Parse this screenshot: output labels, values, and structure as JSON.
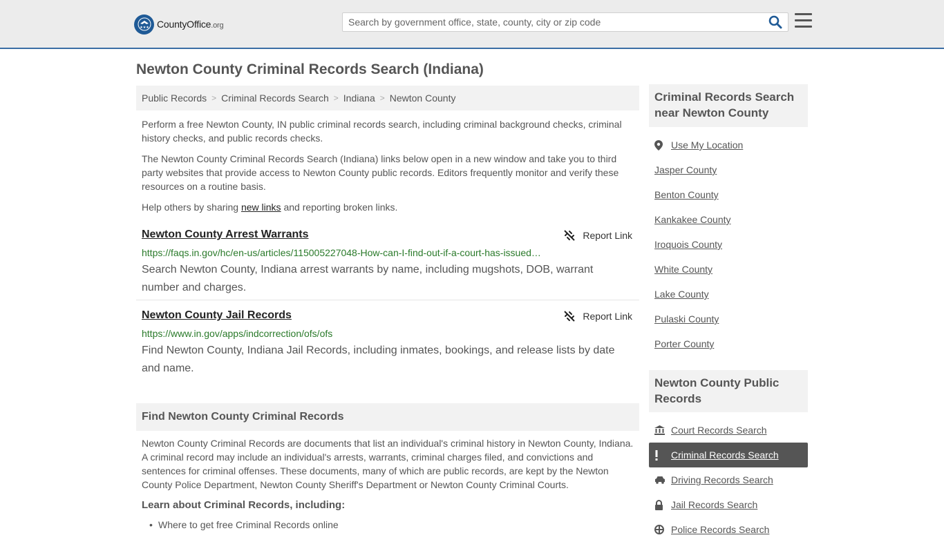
{
  "header": {
    "logo_main": "CountyOffice",
    "logo_tld": ".org",
    "search_placeholder": "Search by government office, state, county, city or zip code"
  },
  "page_title": "Newton County Criminal Records Search (Indiana)",
  "breadcrumb": [
    "Public Records",
    "Criminal Records Search",
    "Indiana",
    "Newton County"
  ],
  "intro": {
    "p1": "Perform a free Newton County, IN public criminal records search, including criminal background checks, criminal history checks, and public records checks.",
    "p2": "The Newton County Criminal Records Search (Indiana) links below open in a new window and take you to third party websites that provide access to Newton County public records. Editors frequently monitor and verify these resources on a routine basis.",
    "p3_before": "Help others by sharing ",
    "p3_link": "new links",
    "p3_after": " and reporting broken links."
  },
  "records": [
    {
      "title": "Newton County Arrest Warrants",
      "report_label": "Report Link",
      "url": "https://faqs.in.gov/hc/en-us/articles/115005227048-How-can-I-find-out-if-a-court-has-issued…",
      "description": "Search Newton County, Indiana arrest warrants by name, including mugshots, DOB, warrant number and charges."
    },
    {
      "title": "Newton County Jail Records",
      "report_label": "Report Link",
      "url": "https://www.in.gov/apps/indcorrection/ofs/ofs",
      "description": "Find Newton County, Indiana Jail Records, including inmates, bookings, and release lists by date and name."
    }
  ],
  "find_section": {
    "heading": "Find Newton County Criminal Records",
    "body": "Newton County Criminal Records are documents that list an individual's criminal history in Newton County, Indiana. A criminal record may include an individual's arrests, warrants, criminal charges filed, and convictions and sentences for criminal offenses. These documents, many of which are public records, are kept by the Newton County Police Department, Newton County Sheriff's Department or Newton County Criminal Courts.",
    "learn_heading": "Learn about Criminal Records, including:",
    "bullets": [
      "Where to get free Criminal Records online"
    ]
  },
  "sidebar": {
    "nearby_heading": "Criminal Records Search near Newton County",
    "use_location": "Use My Location",
    "nearby": [
      "Jasper County",
      "Benton County",
      "Kankakee County",
      "Iroquois County",
      "White County",
      "Lake County",
      "Pulaski County",
      "Porter County"
    ],
    "public_heading": "Newton County Public Records",
    "public_links": [
      {
        "label": "Court Records Search",
        "icon": "courthouse-icon",
        "active": false
      },
      {
        "label": "Criminal Records Search",
        "icon": "exclamation-icon",
        "active": true
      },
      {
        "label": "Driving Records Search",
        "icon": "car-icon",
        "active": false
      },
      {
        "label": "Jail Records Search",
        "icon": "lock-icon",
        "active": false
      },
      {
        "label": "Police Records Search",
        "icon": "police-icon",
        "active": false
      }
    ]
  },
  "colors": {
    "accent": "#3b6ea5",
    "url_green": "#2a7a2a",
    "active_bg": "#555555"
  }
}
